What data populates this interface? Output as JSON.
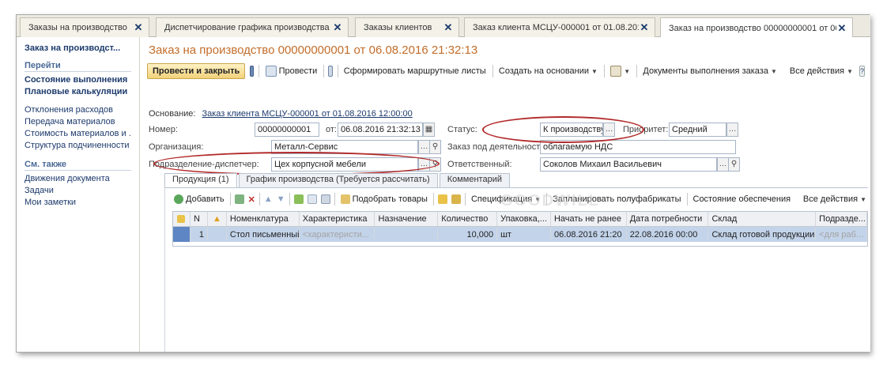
{
  "tabs": [
    {
      "label": "Заказы на производство"
    },
    {
      "label": "Диспетчирование графика производства"
    },
    {
      "label": "Заказы клиентов"
    },
    {
      "label": "Заказ клиента МСЦУ-000001 от 01.08.201..."
    },
    {
      "label": "Заказ на производство 00000000001 от 06..."
    }
  ],
  "sidebar": {
    "title": "Заказ на производст...",
    "go_header": "Перейти",
    "go_bold": [
      "Состояние выполнения",
      "Плановые калькуляции"
    ],
    "go_links": [
      "Отклонения расходов",
      "Передача материалов",
      "Стоимость материалов и ...",
      "Структура подчиненности"
    ],
    "see_header": "См. также",
    "see_links": [
      "Движения документа",
      "Задачи",
      "Мои заметки"
    ]
  },
  "doc_title": "Заказ на производство 00000000001 от 06.08.2016 21:32:13",
  "toolbar": {
    "post_close": "Провести и закрыть",
    "post": "Провести",
    "route_sheets": "Сформировать маршрутные листы",
    "create_based": "Создать на основании",
    "docs_exec": "Документы выполнения заказа",
    "all_actions": "Все действия"
  },
  "form": {
    "base_label": "Основание:",
    "base_link": "Заказ клиента МСЦУ-000001 от 01.08.2016 12:00:00",
    "number_label": "Номер:",
    "number_value": "00000000001",
    "date_label": "от:",
    "date_value": "06.08.2016 21:32:13",
    "status_label": "Статус:",
    "status_value": "К производству",
    "priority_label": "Приоритет:",
    "priority_value": "Средний",
    "org_label": "Организация:",
    "org_value": "Металл-Сервис",
    "activity_label": "Заказ под деятельность:",
    "activity_value": "облагаемую НДС",
    "dept_label": "Подразделение-диспетчер:",
    "dept_value": "Цех корпусной мебели",
    "resp_label": "Ответственный:",
    "resp_value": "Соколов Михаил Васильевич"
  },
  "form_tabs": [
    "Продукция (1)",
    "График производства (Требуется рассчитать)",
    "Комментарий"
  ],
  "table_toolbar": {
    "add": "Добавить",
    "pick": "Подобрать товары",
    "spec": "Спецификация",
    "plan_semi": "Запланировать полуфабрикаты",
    "supply_state": "Состояние обеспечения",
    "all_actions": "Все действия"
  },
  "table": {
    "columns": [
      "N",
      "Номенклатура",
      "Характеристика",
      "Назначение",
      "Количество",
      "Упаковка,...",
      "Начать не ранее",
      "Дата потребности",
      "Склад",
      "Подразде..."
    ],
    "rows": [
      {
        "n": "1",
        "item": "Стол письменный",
        "char": "<характеристи...",
        "purpose": "",
        "qty": "10,000",
        "pack": "шт",
        "start": "06.08.2016 21:20",
        "need": "22.08.2016 00:00",
        "store": "Склад готовой продукции",
        "dept": "<для раб..."
      }
    ]
  },
  "watermark": "GOODWILL",
  "colors": {
    "title": "#c36d2a",
    "link": "#1c3a6c",
    "oval": "#b22a2a",
    "selection": "#c3d4ea"
  }
}
